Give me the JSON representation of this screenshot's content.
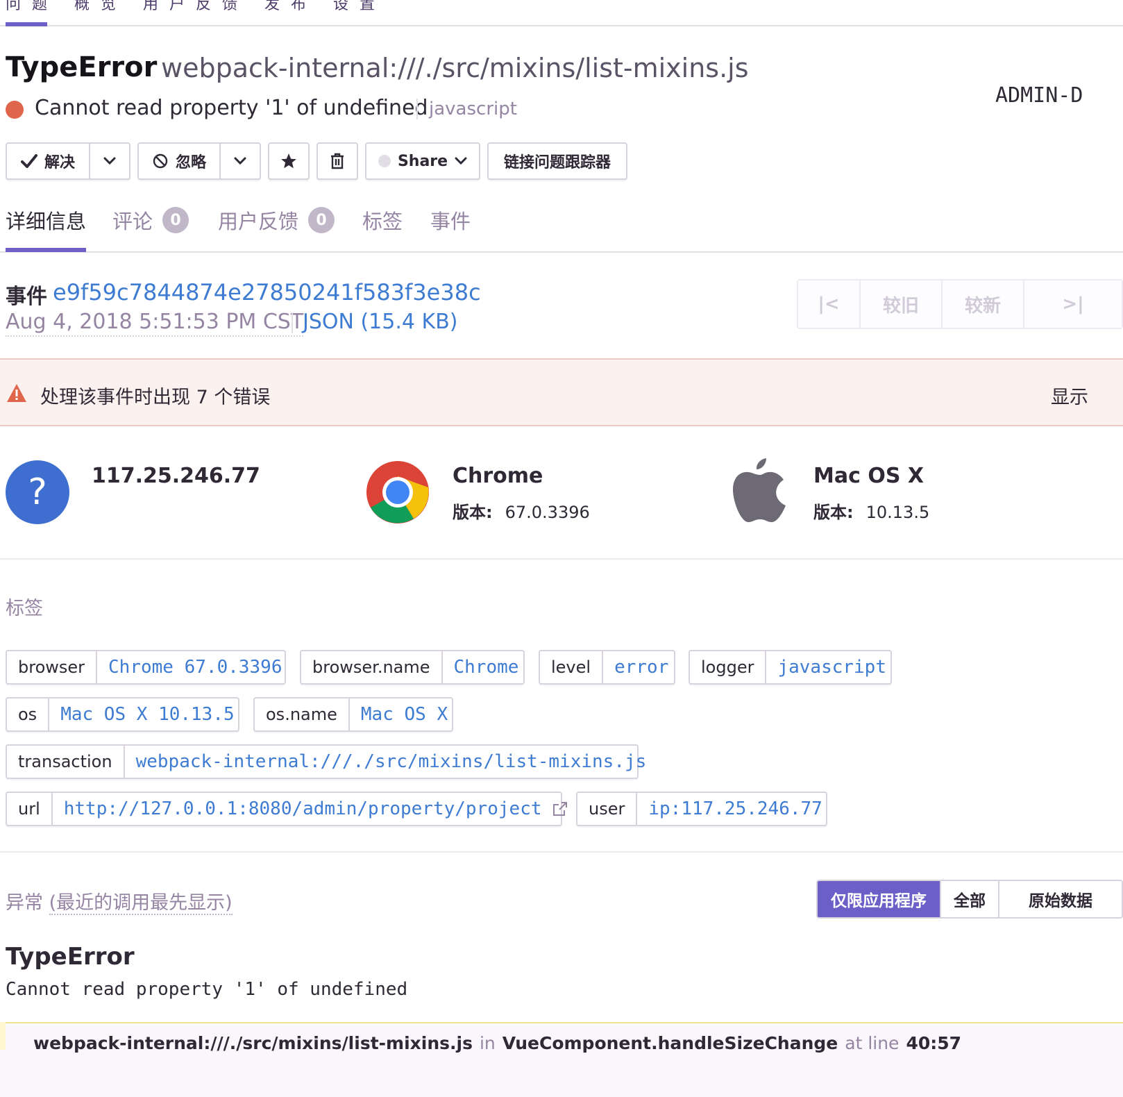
{
  "top_nav": {
    "crumbs": "问题  概览  用户反馈  发布  设置"
  },
  "issue": {
    "type": "TypeError",
    "location": "webpack-internal:///./src/mixins/list-mixins.js",
    "message": "Cannot read property '1' of undefined",
    "platform": "javascript",
    "assignee": "ADMIN-D",
    "severity_color": "#e0664b"
  },
  "actions": {
    "resolve": "解决",
    "ignore": "忽略",
    "share": "Share",
    "issue_tracker": "链接问题跟踪器"
  },
  "tabs": [
    {
      "label": "详细信息"
    },
    {
      "label": "评论",
      "count": "0"
    },
    {
      "label": "用户反馈",
      "count": "0"
    },
    {
      "label": "标签"
    },
    {
      "label": "事件"
    }
  ],
  "event": {
    "label": "事件",
    "id": "e9f59c7844874e27850241f583f3e38c",
    "date": "Aug 4, 2018 5:51:53 PM CST",
    "json": "JSON (15.4 KB)",
    "pager": {
      "first": "|<",
      "older": "较旧",
      "newer": "较新",
      "last": ">|"
    }
  },
  "error_banner": {
    "text": "处理该事件时出现 7 个错误",
    "toggle": "显示"
  },
  "context": {
    "user": {
      "title": "117.25.246.77"
    },
    "browser": {
      "title": "Chrome",
      "version_label": "版本:",
      "version": "67.0.3396"
    },
    "os": {
      "title": "Mac OS X",
      "version_label": "版本:",
      "version": "10.13.5"
    }
  },
  "tags_section": {
    "heading": "标签",
    "items": [
      {
        "key": "browser",
        "value": "Chrome 67.0.3396"
      },
      {
        "key": "browser.name",
        "value": "Chrome"
      },
      {
        "key": "level",
        "value": "error"
      },
      {
        "key": "logger",
        "value": "javascript"
      },
      {
        "key": "os",
        "value": "Mac OS X 10.13.5"
      },
      {
        "key": "os.name",
        "value": "Mac OS X"
      },
      {
        "key": "transaction",
        "value": "webpack-internal:///./src/mixins/list-mixins.js"
      },
      {
        "key": "url",
        "value": "http://127.0.0.1:8080/admin/property/project"
      },
      {
        "key": "user",
        "value": "ip:117.25.246.77"
      }
    ]
  },
  "exception": {
    "heading": "异常",
    "heading_note": "(最近的调用最先显示)",
    "toggles": {
      "app_only": "仅限应用程序",
      "all": "全部",
      "raw": "原始数据"
    },
    "type": "TypeError",
    "value": "Cannot read property '1' of undefined",
    "frame": {
      "file": "webpack-internal:///./src/mixins/list-mixins.js",
      "in_label": "in",
      "function": "VueComponent.handleSizeChange",
      "at_line_label": "at line",
      "line": "40:57"
    }
  },
  "colors": {
    "accent": "#6c5fc7",
    "link": "#3e7bd2",
    "muted": "#9585a3",
    "error": "#e0664b"
  }
}
